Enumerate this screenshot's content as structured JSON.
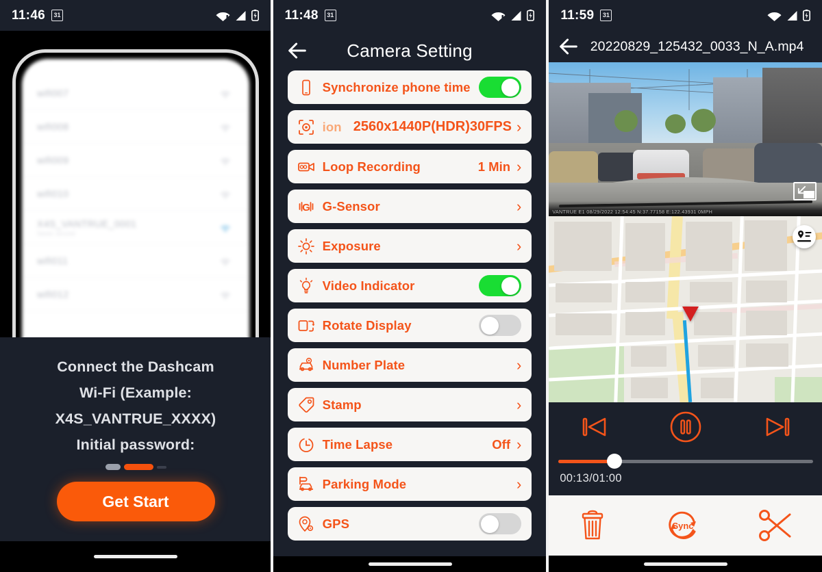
{
  "panel1": {
    "statusbar": {
      "time": "11:46",
      "calendar_day": "31",
      "icons": [
        "wifi-alert-icon",
        "cellular-signal-icon",
        "battery-charging-icon"
      ]
    },
    "phone_mockup": {
      "wifi_list": [
        {
          "name": "wifi007",
          "sub": ""
        },
        {
          "name": "wifi008",
          "sub": ""
        },
        {
          "name": "wifi009",
          "sub": ""
        },
        {
          "name": "wifi010",
          "sub": ""
        },
        {
          "name": "X4S_VANTRUE_0001",
          "sub": "Saved, secured"
        },
        {
          "name": "wifi011",
          "sub": ""
        },
        {
          "name": "wifi012",
          "sub": ""
        }
      ]
    },
    "instructions": [
      "Connect the Dashcam",
      "Wi-Fi (Example:",
      "X4S_VANTRUE_XXXX)",
      "Initial password:"
    ],
    "cta_label": "Get Start"
  },
  "panel2": {
    "statusbar": {
      "time": "11:48",
      "calendar_day": "31"
    },
    "title": "Camera Setting",
    "back_label": "Back",
    "items": [
      {
        "icon": "phone-icon",
        "label": "Synchronize phone time",
        "type": "toggle",
        "state": "on",
        "value": ""
      },
      {
        "icon": "resolution-icon",
        "label": "ion",
        "type": "value",
        "state": "",
        "value": "2560x1440P(HDR)30FPS",
        "faded": true
      },
      {
        "icon": "video-loop-icon",
        "label": "Loop Recording",
        "type": "value",
        "state": "",
        "value": "1 Min"
      },
      {
        "icon": "g-sensor-icon",
        "label": "G-Sensor",
        "type": "arrow",
        "state": "",
        "value": ""
      },
      {
        "icon": "brightness-icon",
        "label": "Exposure",
        "type": "arrow",
        "state": "",
        "value": ""
      },
      {
        "icon": "bulb-icon",
        "label": "Video Indicator",
        "type": "toggle",
        "state": "on",
        "value": ""
      },
      {
        "icon": "rotate-display-icon",
        "label": "Rotate Display",
        "type": "toggle",
        "state": "off",
        "value": ""
      },
      {
        "icon": "number-plate-icon",
        "label": "Number Plate",
        "type": "arrow",
        "state": "",
        "value": ""
      },
      {
        "icon": "tag-icon",
        "label": "Stamp",
        "type": "arrow",
        "state": "",
        "value": ""
      },
      {
        "icon": "clock-icon",
        "label": "Time Lapse",
        "type": "value",
        "state": "",
        "value": "Off"
      },
      {
        "icon": "parking-icon",
        "label": "Parking Mode",
        "type": "arrow",
        "state": "",
        "value": ""
      },
      {
        "icon": "gps-icon",
        "label": "GPS",
        "type": "toggle",
        "state": "off",
        "value": ""
      }
    ]
  },
  "panel3": {
    "statusbar": {
      "time": "11:59",
      "calendar_day": "31"
    },
    "title": "20220829_125432_0033_N_A.mp4",
    "back_label": "Back",
    "video_overlay": "VANTRUE E1 08/29/2022  12:54:45    N:37.77158 E:122.43931 0MPH",
    "pip_button": "picture-in-picture-icon",
    "map_button": "map-layers-icon",
    "controls": {
      "previous": "previous-button",
      "pause": "pause-button",
      "next": "next-button",
      "current_time": "00:13",
      "total_time": "01:00",
      "time_label": "00:13/01:00",
      "progress_percent": 22
    },
    "actions": [
      {
        "icon": "trash-icon",
        "label": ""
      },
      {
        "icon": "sync-icon",
        "label": "Sync"
      },
      {
        "icon": "scissors-icon",
        "label": ""
      }
    ]
  },
  "colors": {
    "accent_orange": "#f4541a",
    "cta_orange": "#fa5a0a",
    "toggle_on_green": "#19dd33",
    "toggle_off_grey": "#d6d6d6",
    "dark_bg": "#1b202b",
    "card_bg": "#f7f6f4"
  }
}
